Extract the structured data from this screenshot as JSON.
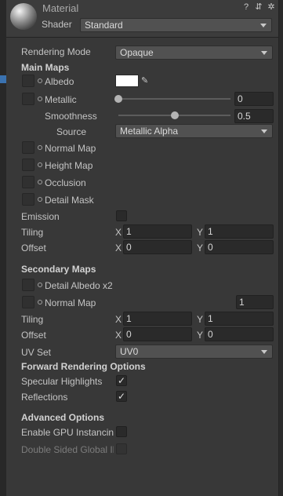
{
  "header": {
    "title": "Material",
    "shader_label": "Shader",
    "shader_value": "Standard"
  },
  "rendering_mode": {
    "label": "Rendering Mode",
    "value": "Opaque"
  },
  "main_maps": {
    "heading": "Main Maps",
    "albedo": {
      "label": "Albedo",
      "color": "#ffffff"
    },
    "metallic": {
      "label": "Metallic",
      "value": "0",
      "level": 0
    },
    "smoothness": {
      "label": "Smoothness",
      "value": "0.5",
      "level": 0.5
    },
    "source": {
      "label": "Source",
      "value": "Metallic Alpha"
    },
    "normal_map": "Normal Map",
    "height_map": "Height Map",
    "occlusion": "Occlusion",
    "detail_mask": "Detail Mask",
    "emission": "Emission",
    "tiling": {
      "label": "Tiling",
      "x_label": "X",
      "x": "1",
      "y_label": "Y",
      "y": "1"
    },
    "offset": {
      "label": "Offset",
      "x_label": "X",
      "x": "0",
      "y_label": "Y",
      "y": "0"
    }
  },
  "secondary_maps": {
    "heading": "Secondary Maps",
    "detail_albedo": "Detail Albedo x2",
    "normal_map": {
      "label": "Normal Map",
      "value": "1"
    },
    "tiling": {
      "label": "Tiling",
      "x_label": "X",
      "x": "1",
      "y_label": "Y",
      "y": "1"
    },
    "offset": {
      "label": "Offset",
      "x_label": "X",
      "x": "0",
      "y_label": "Y",
      "y": "0"
    },
    "uv_set": {
      "label": "UV Set",
      "value": "UV0"
    }
  },
  "forward_options": {
    "heading": "Forward Rendering Options",
    "specular": {
      "label": "Specular Highlights",
      "checked": true,
      "mark": "✓"
    },
    "reflections": {
      "label": "Reflections",
      "checked": true,
      "mark": "✓"
    }
  },
  "advanced": {
    "heading": "Advanced Options",
    "gpu_instancing": "Enable GPU Instancing",
    "double_sided": "Double Sided Global Illumination"
  }
}
